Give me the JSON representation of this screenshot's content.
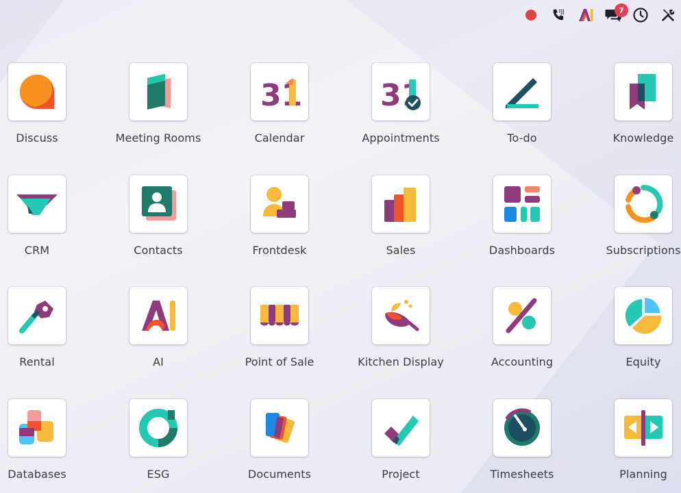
{
  "systray": {
    "notification_count": "7",
    "icons": [
      "recording-indicator-icon",
      "phone-icon",
      "ai-icon",
      "messages-icon",
      "activity-clock-icon",
      "settings-tools-icon"
    ]
  },
  "apps": [
    {
      "label": "Discuss"
    },
    {
      "label": "Meeting Rooms"
    },
    {
      "label": "Calendar",
      "glyph": "31"
    },
    {
      "label": "Appointments",
      "glyph": "31"
    },
    {
      "label": "To-do"
    },
    {
      "label": "Knowledge"
    },
    {
      "label": "CRM"
    },
    {
      "label": "Contacts"
    },
    {
      "label": "Frontdesk"
    },
    {
      "label": "Sales"
    },
    {
      "label": "Dashboards"
    },
    {
      "label": "Subscriptions"
    },
    {
      "label": "Rental"
    },
    {
      "label": "AI"
    },
    {
      "label": "Point of Sale"
    },
    {
      "label": "Kitchen Display"
    },
    {
      "label": "Accounting"
    },
    {
      "label": "Equity"
    },
    {
      "label": "Databases"
    },
    {
      "label": "ESG"
    },
    {
      "label": "Documents"
    },
    {
      "label": "Project"
    },
    {
      "label": "Timesheets"
    },
    {
      "label": "Planning"
    }
  ]
}
